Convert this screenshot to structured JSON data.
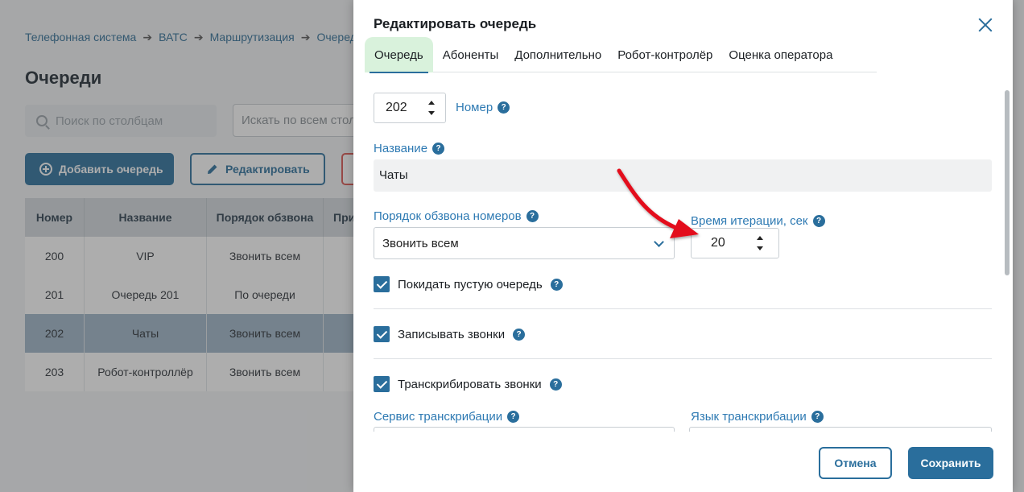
{
  "breadcrumb": {
    "items": [
      "Телефонная система",
      "ВАТС",
      "Маршрутизация",
      "Очереди"
    ],
    "separator": "➔"
  },
  "page": {
    "title": "Очереди",
    "search_placeholder": "Поиск по столбцам",
    "search_all_placeholder": "Искать по всем столбцам",
    "add_button": "Добавить очередь",
    "edit_button": "Редактировать"
  },
  "table": {
    "headers": [
      "Номер",
      "Название",
      "Порядок обзвона",
      "При"
    ],
    "rows": [
      {
        "num": "200",
        "name": "VIP",
        "order": "Звонить всем"
      },
      {
        "num": "201",
        "name": "Очередь 201",
        "order": "По очереди"
      },
      {
        "num": "202",
        "name": "Чаты",
        "order": "Звонить всем"
      },
      {
        "num": "203",
        "name": "Робот-контроллёр",
        "order": "Звонить всем"
      }
    ],
    "selected_row": 2
  },
  "modal": {
    "title": "Редактировать очередь",
    "tabs": [
      "Очередь",
      "Абоненты",
      "Дополнительно",
      "Робот-контролёр",
      "Оценка оператора"
    ],
    "active_tab": 0,
    "help_glyph": "?",
    "number_value": "202",
    "number_label": "Номер",
    "name_label": "Название",
    "name_value": "Чаты",
    "order_label": "Порядок обзвона номеров",
    "order_value": "Звонить всем",
    "iteration_label": "Время итерации, сек",
    "iteration_value": "20",
    "checkboxes": [
      {
        "label": "Покидать пустую очередь",
        "checked": true
      },
      {
        "label": "Записывать звонки",
        "checked": true
      },
      {
        "label": "Транскрибировать звонки",
        "checked": true
      }
    ],
    "transcription_service_label": "Сервис транскрибации",
    "transcription_language_label": "Язык транскрибации",
    "cancel_button": "Отмена",
    "save_button": "Сохранить"
  },
  "colors": {
    "primary": "#2a6e9c",
    "label_blue": "#2e7ab3",
    "active_tab_bg": "#d9f2dc",
    "annotation_arrow": "#e3101c"
  }
}
